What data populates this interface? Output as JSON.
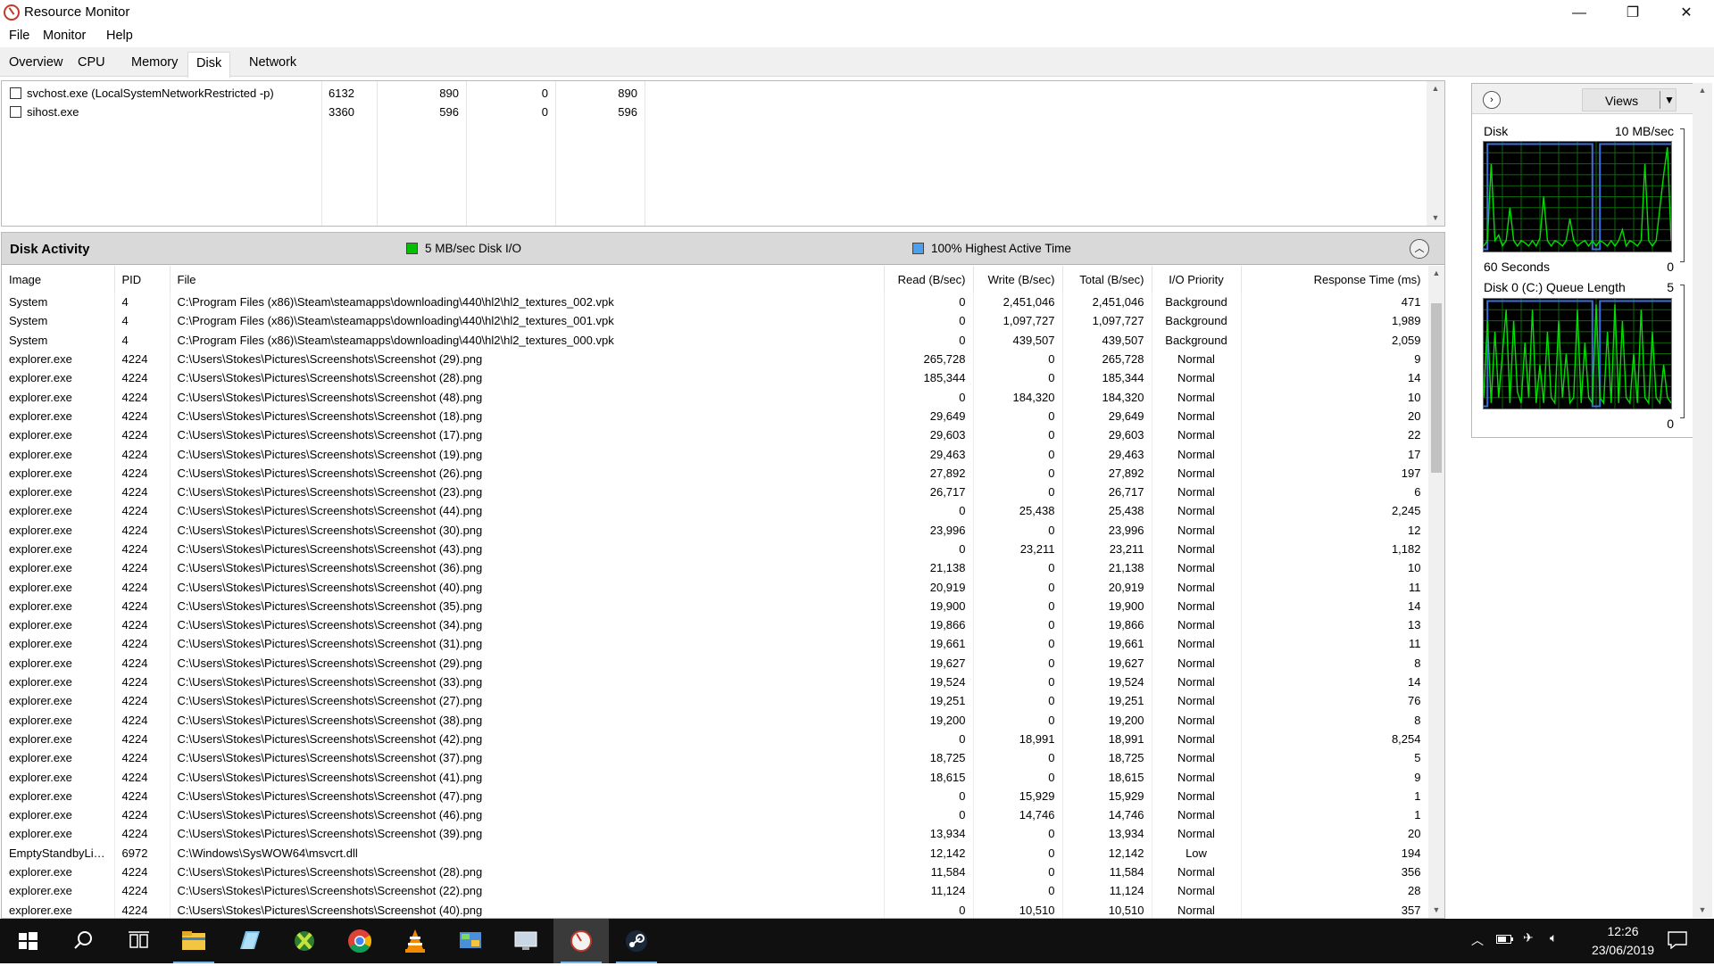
{
  "window": {
    "title": "Resource Monitor",
    "minimize_glyph": "—",
    "restore_glyph": "❐",
    "close_glyph": "✕"
  },
  "menu": [
    "File",
    "Monitor",
    "Help"
  ],
  "tabs": [
    "Overview",
    "CPU",
    "Memory",
    "Disk",
    "Network"
  ],
  "active_tab": "Disk",
  "processes_with_disk_activity": {
    "rows": [
      {
        "image": "svchost.exe (LocalSystemNetworkRestricted -p)",
        "pid": "6132",
        "read": "890",
        "write": "0",
        "total": "890",
        "checked": false
      },
      {
        "image": "sihost.exe",
        "pid": "3360",
        "read": "596",
        "write": "0",
        "total": "596",
        "checked": false
      }
    ]
  },
  "disk_activity": {
    "title": "Disk Activity",
    "legend_io": "5 MB/sec Disk I/O",
    "legend_active": "100% Highest Active Time",
    "io_color": "#00c000",
    "active_color": "#4aa0f0",
    "columns": [
      "Image",
      "PID",
      "File",
      "Read (B/sec)",
      "Write (B/sec)",
      "Total (B/sec)",
      "I/O Priority",
      "Response Time (ms)"
    ],
    "rows": [
      [
        "System",
        "4",
        "C:\\Program Files (x86)\\Steam\\steamapps\\downloading\\440\\hl2\\hl2_textures_002.vpk",
        "0",
        "2,451,046",
        "2,451,046",
        "Background",
        "471"
      ],
      [
        "System",
        "4",
        "C:\\Program Files (x86)\\Steam\\steamapps\\downloading\\440\\hl2\\hl2_textures_001.vpk",
        "0",
        "1,097,727",
        "1,097,727",
        "Background",
        "1,989"
      ],
      [
        "System",
        "4",
        "C:\\Program Files (x86)\\Steam\\steamapps\\downloading\\440\\hl2\\hl2_textures_000.vpk",
        "0",
        "439,507",
        "439,507",
        "Background",
        "2,059"
      ],
      [
        "explorer.exe",
        "4224",
        "C:\\Users\\Stokes\\Pictures\\Screenshots\\Screenshot (29).png",
        "265,728",
        "0",
        "265,728",
        "Normal",
        "9"
      ],
      [
        "explorer.exe",
        "4224",
        "C:\\Users\\Stokes\\Pictures\\Screenshots\\Screenshot (28).png",
        "185,344",
        "0",
        "185,344",
        "Normal",
        "14"
      ],
      [
        "explorer.exe",
        "4224",
        "C:\\Users\\Stokes\\Pictures\\Screenshots\\Screenshot (48).png",
        "0",
        "184,320",
        "184,320",
        "Normal",
        "10"
      ],
      [
        "explorer.exe",
        "4224",
        "C:\\Users\\Stokes\\Pictures\\Screenshots\\Screenshot (18).png",
        "29,649",
        "0",
        "29,649",
        "Normal",
        "20"
      ],
      [
        "explorer.exe",
        "4224",
        "C:\\Users\\Stokes\\Pictures\\Screenshots\\Screenshot (17).png",
        "29,603",
        "0",
        "29,603",
        "Normal",
        "22"
      ],
      [
        "explorer.exe",
        "4224",
        "C:\\Users\\Stokes\\Pictures\\Screenshots\\Screenshot (19).png",
        "29,463",
        "0",
        "29,463",
        "Normal",
        "17"
      ],
      [
        "explorer.exe",
        "4224",
        "C:\\Users\\Stokes\\Pictures\\Screenshots\\Screenshot (26).png",
        "27,892",
        "0",
        "27,892",
        "Normal",
        "197"
      ],
      [
        "explorer.exe",
        "4224",
        "C:\\Users\\Stokes\\Pictures\\Screenshots\\Screenshot (23).png",
        "26,717",
        "0",
        "26,717",
        "Normal",
        "6"
      ],
      [
        "explorer.exe",
        "4224",
        "C:\\Users\\Stokes\\Pictures\\Screenshots\\Screenshot (44).png",
        "0",
        "25,438",
        "25,438",
        "Normal",
        "2,245"
      ],
      [
        "explorer.exe",
        "4224",
        "C:\\Users\\Stokes\\Pictures\\Screenshots\\Screenshot (30).png",
        "23,996",
        "0",
        "23,996",
        "Normal",
        "12"
      ],
      [
        "explorer.exe",
        "4224",
        "C:\\Users\\Stokes\\Pictures\\Screenshots\\Screenshot (43).png",
        "0",
        "23,211",
        "23,211",
        "Normal",
        "1,182"
      ],
      [
        "explorer.exe",
        "4224",
        "C:\\Users\\Stokes\\Pictures\\Screenshots\\Screenshot (36).png",
        "21,138",
        "0",
        "21,138",
        "Normal",
        "10"
      ],
      [
        "explorer.exe",
        "4224",
        "C:\\Users\\Stokes\\Pictures\\Screenshots\\Screenshot (40).png",
        "20,919",
        "0",
        "20,919",
        "Normal",
        "11"
      ],
      [
        "explorer.exe",
        "4224",
        "C:\\Users\\Stokes\\Pictures\\Screenshots\\Screenshot (35).png",
        "19,900",
        "0",
        "19,900",
        "Normal",
        "14"
      ],
      [
        "explorer.exe",
        "4224",
        "C:\\Users\\Stokes\\Pictures\\Screenshots\\Screenshot (34).png",
        "19,866",
        "0",
        "19,866",
        "Normal",
        "13"
      ],
      [
        "explorer.exe",
        "4224",
        "C:\\Users\\Stokes\\Pictures\\Screenshots\\Screenshot (31).png",
        "19,661",
        "0",
        "19,661",
        "Normal",
        "11"
      ],
      [
        "explorer.exe",
        "4224",
        "C:\\Users\\Stokes\\Pictures\\Screenshots\\Screenshot (29).png",
        "19,627",
        "0",
        "19,627",
        "Normal",
        "8"
      ],
      [
        "explorer.exe",
        "4224",
        "C:\\Users\\Stokes\\Pictures\\Screenshots\\Screenshot (33).png",
        "19,524",
        "0",
        "19,524",
        "Normal",
        "14"
      ],
      [
        "explorer.exe",
        "4224",
        "C:\\Users\\Stokes\\Pictures\\Screenshots\\Screenshot (27).png",
        "19,251",
        "0",
        "19,251",
        "Normal",
        "76"
      ],
      [
        "explorer.exe",
        "4224",
        "C:\\Users\\Stokes\\Pictures\\Screenshots\\Screenshot (38).png",
        "19,200",
        "0",
        "19,200",
        "Normal",
        "8"
      ],
      [
        "explorer.exe",
        "4224",
        "C:\\Users\\Stokes\\Pictures\\Screenshots\\Screenshot (42).png",
        "0",
        "18,991",
        "18,991",
        "Normal",
        "8,254"
      ],
      [
        "explorer.exe",
        "4224",
        "C:\\Users\\Stokes\\Pictures\\Screenshots\\Screenshot (37).png",
        "18,725",
        "0",
        "18,725",
        "Normal",
        "5"
      ],
      [
        "explorer.exe",
        "4224",
        "C:\\Users\\Stokes\\Pictures\\Screenshots\\Screenshot (41).png",
        "18,615",
        "0",
        "18,615",
        "Normal",
        "9"
      ],
      [
        "explorer.exe",
        "4224",
        "C:\\Users\\Stokes\\Pictures\\Screenshots\\Screenshot (47).png",
        "0",
        "15,929",
        "15,929",
        "Normal",
        "1"
      ],
      [
        "explorer.exe",
        "4224",
        "C:\\Users\\Stokes\\Pictures\\Screenshots\\Screenshot (46).png",
        "0",
        "14,746",
        "14,746",
        "Normal",
        "1"
      ],
      [
        "explorer.exe",
        "4224",
        "C:\\Users\\Stokes\\Pictures\\Screenshots\\Screenshot (39).png",
        "13,934",
        "0",
        "13,934",
        "Normal",
        "20"
      ],
      [
        "EmptyStandbyList...",
        "6972",
        "C:\\Windows\\SysWOW64\\msvcrt.dll",
        "12,142",
        "0",
        "12,142",
        "Low",
        "194"
      ],
      [
        "explorer.exe",
        "4224",
        "C:\\Users\\Stokes\\Pictures\\Screenshots\\Screenshot (28).png",
        "11,584",
        "0",
        "11,584",
        "Normal",
        "356"
      ],
      [
        "explorer.exe",
        "4224",
        "C:\\Users\\Stokes\\Pictures\\Screenshots\\Screenshot (22).png",
        "11,124",
        "0",
        "11,124",
        "Normal",
        "28"
      ],
      [
        "explorer.exe",
        "4224",
        "C:\\Users\\Stokes\\Pictures\\Screenshots\\Screenshot (40).png",
        "0",
        "10,510",
        "10,510",
        "Normal",
        "357"
      ]
    ]
  },
  "right_panel": {
    "views_label": "Views",
    "graph_disk": {
      "label": "Disk",
      "max_label": "10 MB/sec",
      "duration_label": "60 Seconds",
      "min_label": "0"
    },
    "graph_queue": {
      "label": "Disk 0 (C:) Queue Length",
      "max_label": "5",
      "min_label": "0"
    },
    "graph_color": "#00e000",
    "graph_active_color": "#3a6fd8"
  },
  "taskbar": {
    "icons": [
      "windows-start-icon",
      "search-icon",
      "task-view-icon",
      "file-explorer-icon",
      "notepad-icon",
      "xbox-icon",
      "chrome-icon",
      "vlc-icon",
      "control-panel-icon",
      "display-settings-icon",
      "resource-monitor-icon",
      "steam-icon"
    ],
    "clock_time": "12:26",
    "clock_date": "23/06/2019"
  }
}
